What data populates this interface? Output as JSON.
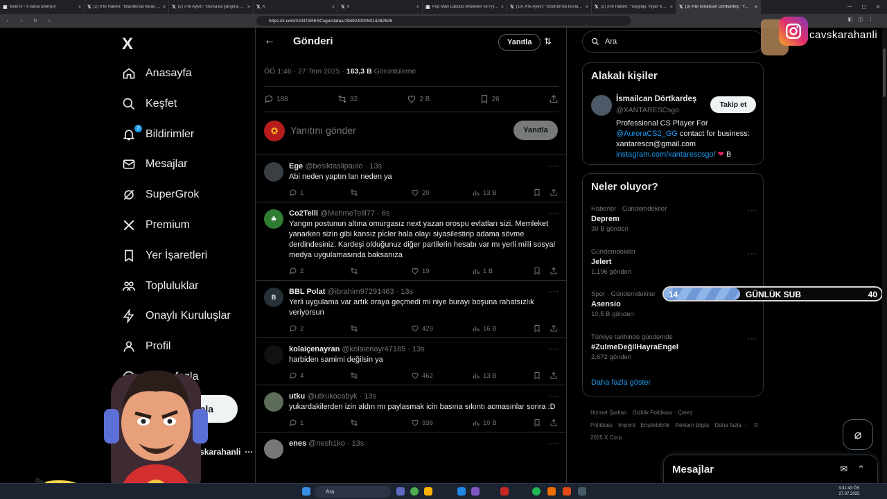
{
  "browser": {
    "tabs": [
      {
        "title": "Multi tv - 9 kanal izleniyor",
        "icon": "multitv-icon"
      },
      {
        "title": "(2) X'te Haberi: \"İstanbul'da haraç al...",
        "icon": "x-icon"
      },
      {
        "title": "(2) X'te Aykırı: \"Bursa'da yangına müd...",
        "icon": "x-icon"
      },
      {
        "title": "X",
        "icon": "x-icon"
      },
      {
        "title": "X",
        "icon": "x-icon"
      },
      {
        "title": "Pop Mart Labubu Modelleri ve Fiyatla...",
        "icon": "popmart-icon"
      },
      {
        "title": "(10) X'te Aykırı: \"Bodrum'da tsunami...",
        "icon": "x-icon"
      },
      {
        "title": "(2) X'te Haberi: \"Yargıtay, 'hiyar' kelim...",
        "icon": "x-icon"
      },
      {
        "title": "(3) X'te İsmailcan Dörtkardeş: \"Y...",
        "icon": "x-icon",
        "active": true
      }
    ],
    "url": "https://x.com/XANTARESCsgo/status/1949240005014282626"
  },
  "nav": {
    "logo": "X",
    "items": [
      {
        "label": "Anasayfa",
        "icon": "home-icon"
      },
      {
        "label": "Keşfet",
        "icon": "search-icon"
      },
      {
        "label": "Bildirimler",
        "icon": "bell-icon",
        "badge": "3"
      },
      {
        "label": "Mesajlar",
        "icon": "mail-icon"
      },
      {
        "label": "SuperGrok",
        "icon": "grok-icon"
      },
      {
        "label": "Premium",
        "icon": "x-premium-icon"
      },
      {
        "label": "Yer İşaretleri",
        "icon": "bookmark-icon"
      },
      {
        "label": "Topluluklar",
        "icon": "communities-icon"
      },
      {
        "label": "Onaylı Kuruluşlar",
        "icon": "lightning-icon"
      },
      {
        "label": "Profil",
        "icon": "profile-icon"
      },
      {
        "label": "Daha fazla",
        "icon": "more-circle-icon"
      }
    ],
    "post_button": "Gönderi yayınla",
    "profile_name": "cavskarahanli"
  },
  "center": {
    "title": "Gönderi",
    "reply_filter": "Yanıtla",
    "meta_time": "ÖÖ 1:46 · 27 Tem 2025 · ",
    "meta_views": "163,3 B",
    "meta_views_label": " Görüntüleme",
    "stats": {
      "replies": "188",
      "reposts": "32",
      "likes": "2 B",
      "bookmarks": "26"
    },
    "composer_placeholder": "Yanıtını gönder",
    "reply_button": "Yanıtla"
  },
  "replies": [
    {
      "name": "Ege",
      "handle": "@besiktaslipaulo",
      "time": "· 13s",
      "text": "Abi neden yaptın lan neden ya",
      "replies": "1",
      "reposts": "",
      "likes": "20",
      "views": "13 B",
      "avatar_color": "#3a3f44",
      "avatar_text": ""
    },
    {
      "name": "Co2Telli",
      "handle": "@MehmeTelli77",
      "time": "· 6s",
      "text": "Yangın postunun altına omurgasız next  yazan orospu evlatları sizi. Memleket yanarken sizin gibi kansız pi̇cler hala olayı siyasilestirip adama sövme derdindesiniz. Kardeşi olduğunuz diğer partilerin hesabı var mı yerli milli sosyal medya uygulamasında baksanıza",
      "replies": "2",
      "reposts": "",
      "likes": "19",
      "views": "1 B",
      "avatar_color": "#2e7d32",
      "avatar_text": "☘"
    },
    {
      "name": "BBL Polat",
      "handle": "@ibrahim97291463",
      "time": "· 13s",
      "text": "Yerli uygulama var artık oraya geçmedi mi niye burayı boşuna rahatsızlık veriyorsun",
      "replies": "2",
      "reposts": "",
      "likes": "429",
      "views": "16 B",
      "avatar_color": "#263238",
      "avatar_text": "B"
    },
    {
      "name": "kolaiçenayran",
      "handle": "@kolaienayr47185",
      "time": "· 13s",
      "text": "harbiden samimi değilsin ya",
      "replies": "4",
      "reposts": "",
      "likes": "462",
      "views": "13 B",
      "avatar_color": "#111111",
      "avatar_text": ""
    },
    {
      "name": "utku",
      "handle": "@utkukocabyk",
      "time": "· 13s",
      "text": "yukardakilerden izin aldın mı paylasmak icin basına sıkıntı acmasınlar sonra :D",
      "replies": "1",
      "reposts": "",
      "likes": "336",
      "views": "10 B",
      "avatar_color": "#5d6d5a",
      "avatar_text": ""
    },
    {
      "name": "enes",
      "handle": "@nesh1ko",
      "time": "· 13s",
      "text": "",
      "replies": "",
      "reposts": "",
      "likes": "",
      "views": "",
      "avatar_color": "#777777",
      "avatar_text": ""
    }
  ],
  "right": {
    "search_placeholder": "Ara",
    "related_title": "Alakalı kişiler",
    "related": {
      "name": "İsmailcan Dörtkardeş",
      "handle": "@XANTARESCsgo",
      "follow": "Takip et",
      "bio_line1": "Professional CS Player For ",
      "bio_link1": "@AuroraCS2_GG",
      "bio_line2": " contact for business: xantarescn@gmail.com ",
      "bio_link2": "instagram.com/xantarescsgo/",
      "bio_end": " B"
    },
    "trending_title": "Neler oluyor?",
    "trends": [
      {
        "category": "Haberler · Gündemdekiler",
        "name": "Deprem",
        "count": "30 B gönderi"
      },
      {
        "category": "Gündemdekiler",
        "name": "Jelert",
        "count": "1.196 gönderi"
      },
      {
        "category": "Spor · Gündemdekiler",
        "name": "Asensio",
        "count": "10,5 B gönderi"
      },
      {
        "category": "Türkiye tarihinde gündemde",
        "name": "#ZulmeDeğilHayraEngel",
        "count": "2.672 gönderi"
      }
    ],
    "show_more": "Daha fazla göster",
    "footer": [
      "Hizmet Şartları",
      "Gizlilik Politikası",
      "Çerez Politikası",
      "Imprint",
      "Erişilebilirlik",
      "Reklam bilgisi",
      "Daha fazla ···",
      "© 2025 X Corp."
    ]
  },
  "overlay": {
    "instagram_handle": "cavskarahanli",
    "sub_current": "14",
    "sub_label": "GÜNLÜK SUB",
    "sub_goal": "40",
    "sub_progress": 0.35,
    "messages_title": "Mesajlar"
  },
  "taskbar": {
    "search": "Ara",
    "time": "3:31:43 ÖS",
    "date": "27.07.2025"
  }
}
